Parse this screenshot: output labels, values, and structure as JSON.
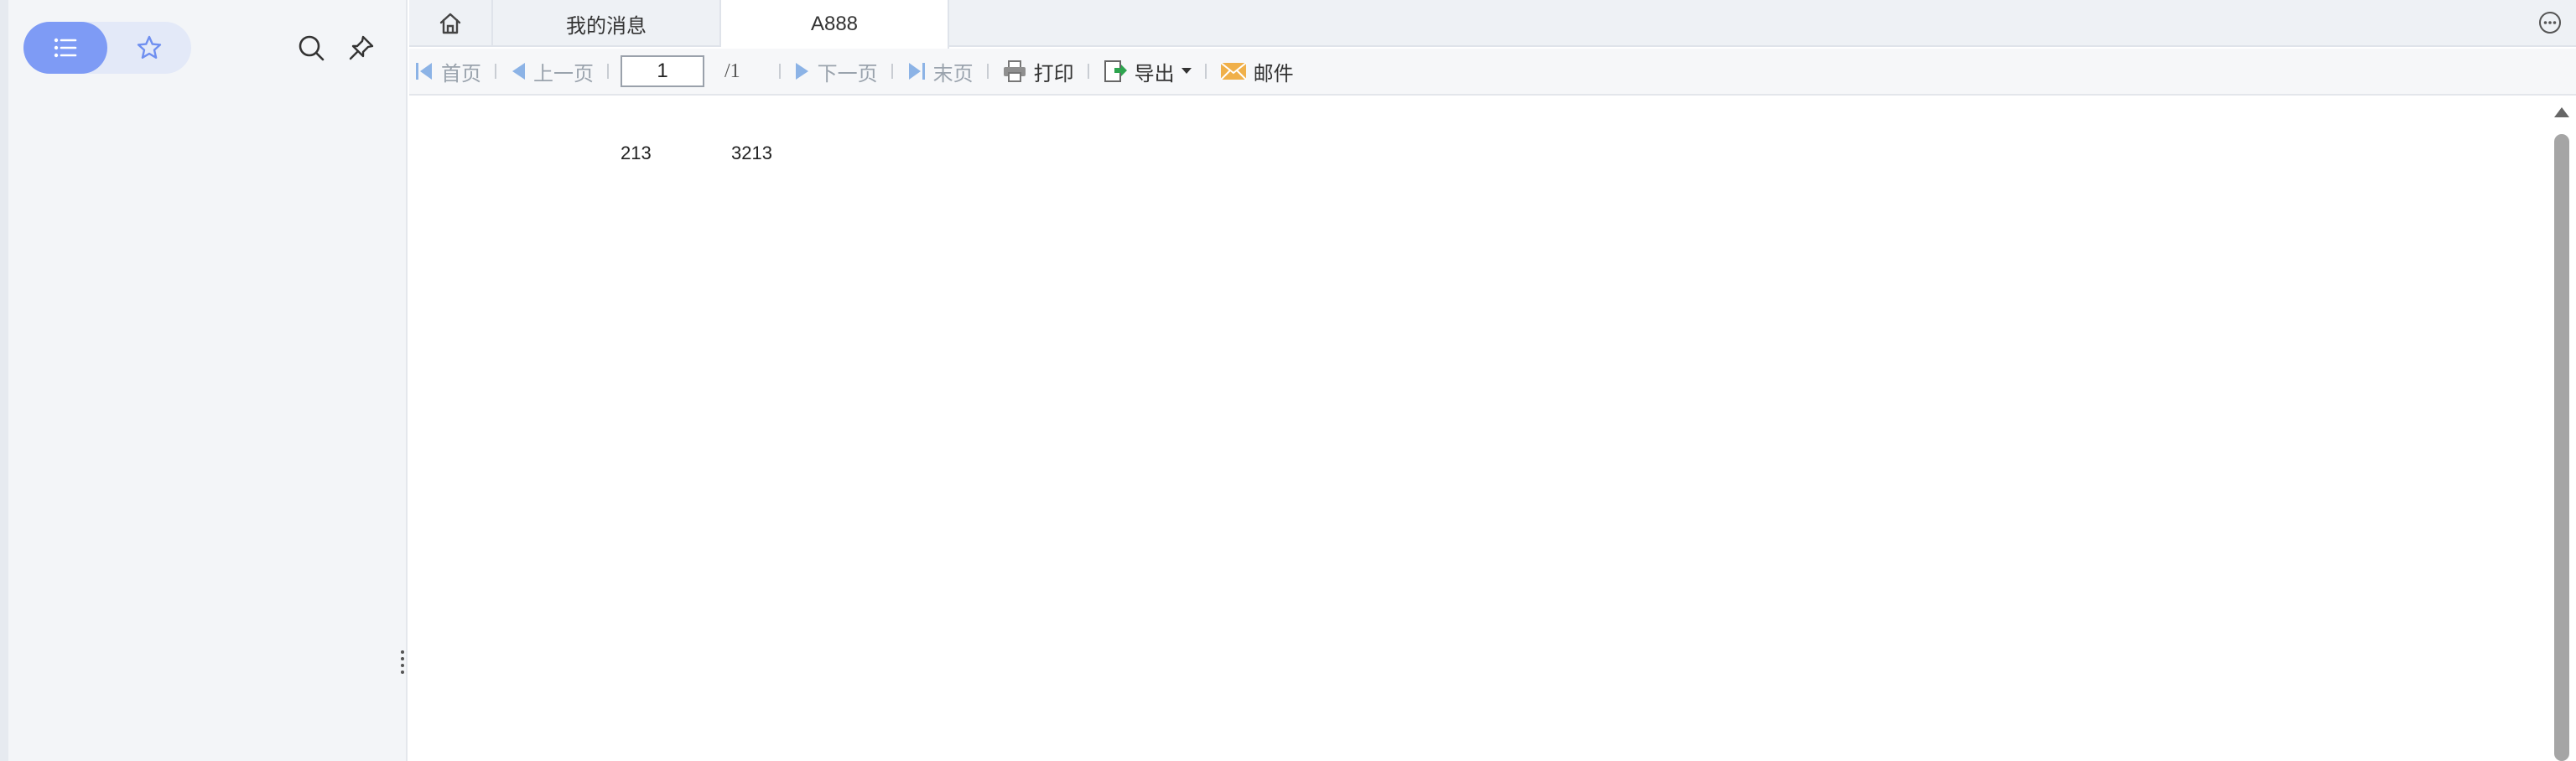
{
  "sidebar": {
    "icons": {
      "list": "list-icon",
      "favorite": "star-icon",
      "search": "search-icon",
      "pin": "pin-icon"
    },
    "accent": "#7e9bf5"
  },
  "tabs": [
    {
      "label": "",
      "icon": "home-icon"
    },
    {
      "label": "我的消息"
    },
    {
      "label": "A888",
      "active": true
    }
  ],
  "toolbar": {
    "first": "首页",
    "prev": "上一页",
    "page_value": "1",
    "page_total": "/1",
    "next": "下一页",
    "last": "末页",
    "print": "打印",
    "export": "导出",
    "mail": "邮件"
  },
  "report": {
    "cells": [
      "213",
      "3213"
    ]
  }
}
